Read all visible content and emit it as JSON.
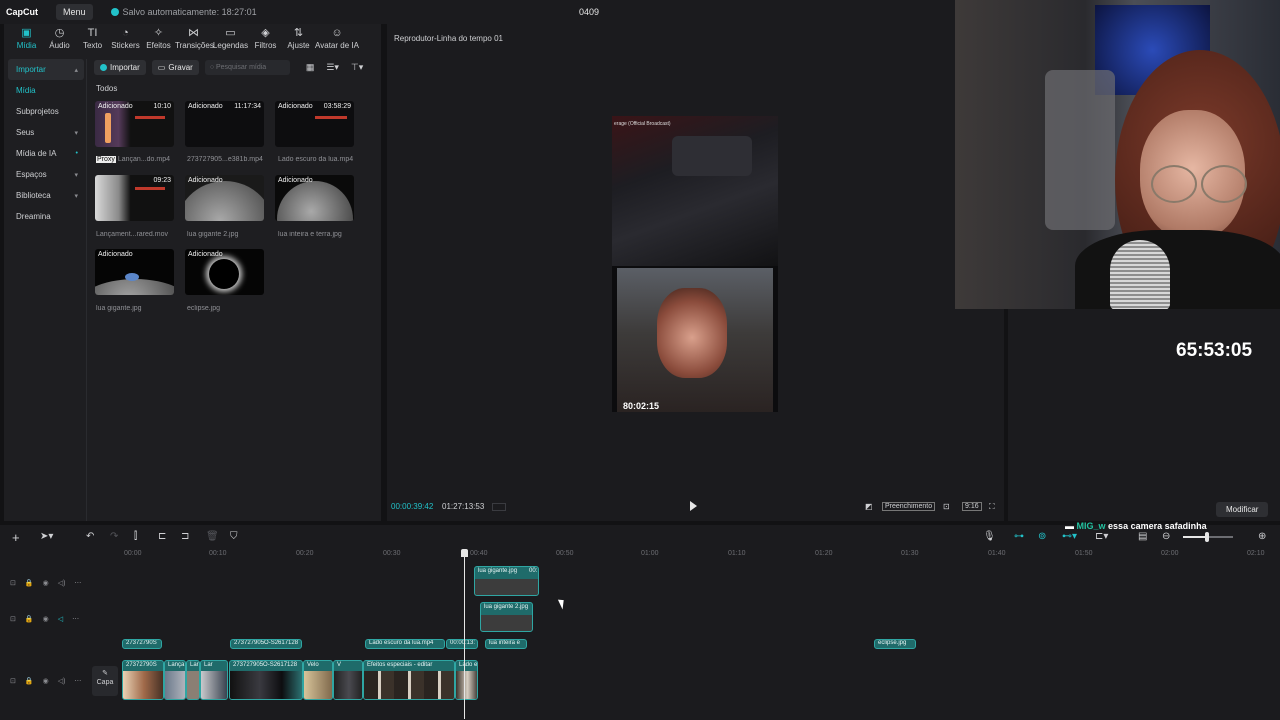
{
  "app": {
    "logo": "CapCut",
    "menu_label": "Menu",
    "autosave": "Salvo automaticamente: 18:27:01",
    "project_name": "0409"
  },
  "toolbar_tabs": [
    {
      "label": "Mídia",
      "icon": "media-icon"
    },
    {
      "label": "Áudio",
      "icon": "audio-icon"
    },
    {
      "label": "Texto",
      "icon": "text-icon"
    },
    {
      "label": "Stickers",
      "icon": "sticker-icon"
    },
    {
      "label": "Efeitos",
      "icon": "effects-icon"
    },
    {
      "label": "Transições",
      "icon": "transitions-icon"
    },
    {
      "label": "Legendas",
      "icon": "captions-icon"
    },
    {
      "label": "Filtros",
      "icon": "filters-icon"
    },
    {
      "label": "Ajuste",
      "icon": "adjust-icon"
    },
    {
      "label": "Avatar de IA",
      "icon": "avatar-icon"
    }
  ],
  "left_nav": [
    {
      "label": "Importar",
      "caret": "▴"
    },
    {
      "label": "Mídia",
      "caret": ""
    },
    {
      "label": "Subprojetos",
      "caret": ""
    },
    {
      "label": "Seus",
      "caret": "▾"
    },
    {
      "label": "Mídia de IA",
      "caret": "•"
    },
    {
      "label": "Espaços",
      "caret": "▾"
    },
    {
      "label": "Biblioteca",
      "caret": "▾"
    },
    {
      "label": "Dreamina",
      "caret": ""
    }
  ],
  "media_toolbar": {
    "import_label": "Importar",
    "record_label": "Gravar",
    "search_placeholder": "Pesquisar mídia"
  },
  "media_section": "Todos",
  "media_items": [
    {
      "tag": "Adicionado",
      "duration": "10:10",
      "name": "Lançan...do.mp4",
      "proxy": "Proxy"
    },
    {
      "tag": "Adicionado",
      "duration": "11:17:34",
      "name": "273727905...e381b.mp4"
    },
    {
      "tag": "Adicionado",
      "duration": "03:58:29",
      "name": "Lado escuro da lua.mp4"
    },
    {
      "tag": "",
      "duration": "09:23",
      "name": "Lançament...rared.mov"
    },
    {
      "tag": "Adicionado",
      "duration": "",
      "name": "lua gigante 2.jpg"
    },
    {
      "tag": "Adicionado",
      "duration": "",
      "name": "lua inteira e terra.jpg"
    },
    {
      "tag": "Adicionado",
      "duration": "",
      "name": "lua gigante.jpg"
    },
    {
      "tag": "Adicionado",
      "duration": "",
      "name": "eclipse.jpg"
    }
  ],
  "player": {
    "title": "Reprodutor-Linha do tempo 01",
    "preview_caption": "erage (Official Broadcast)",
    "preview_timer": "80:02:15",
    "current_time": "00:00:39:42",
    "total_time": "01:27:13:53",
    "fill_label": "Preenchimento",
    "ratio_label": "9:16"
  },
  "overlay": {
    "stream_timer": "65:53:05",
    "chat_user": "MIG_w",
    "chat_message": "essa camera safadinha"
  },
  "properties": {
    "modify_label": "Modificar"
  },
  "timeline": {
    "ruler_ticks": [
      "00:00",
      "00:10",
      "00:20",
      "00:30",
      "00:40",
      "00:50",
      "01:00",
      "01:10",
      "01:20",
      "01:30",
      "01:40",
      "01:50",
      "02:00",
      "02:10"
    ],
    "overlay_clips": [
      "lua gigante.jpg",
      "00:",
      "lua gigante 2.jpg"
    ],
    "text_clips": [
      "27372790S",
      "273727905O-S2617128",
      "Lado escuro da lua.mp4",
      "00:00:13:",
      "lua inteira e",
      "eclipse.jpg"
    ],
    "main_clip_labels": [
      "27372790S",
      "Lança",
      "Lar",
      "Lar",
      "273727905O-S2617128",
      "Velo",
      "V",
      "Efeitos especiais - editar",
      "Lado e"
    ],
    "cover_label": "Capa"
  }
}
